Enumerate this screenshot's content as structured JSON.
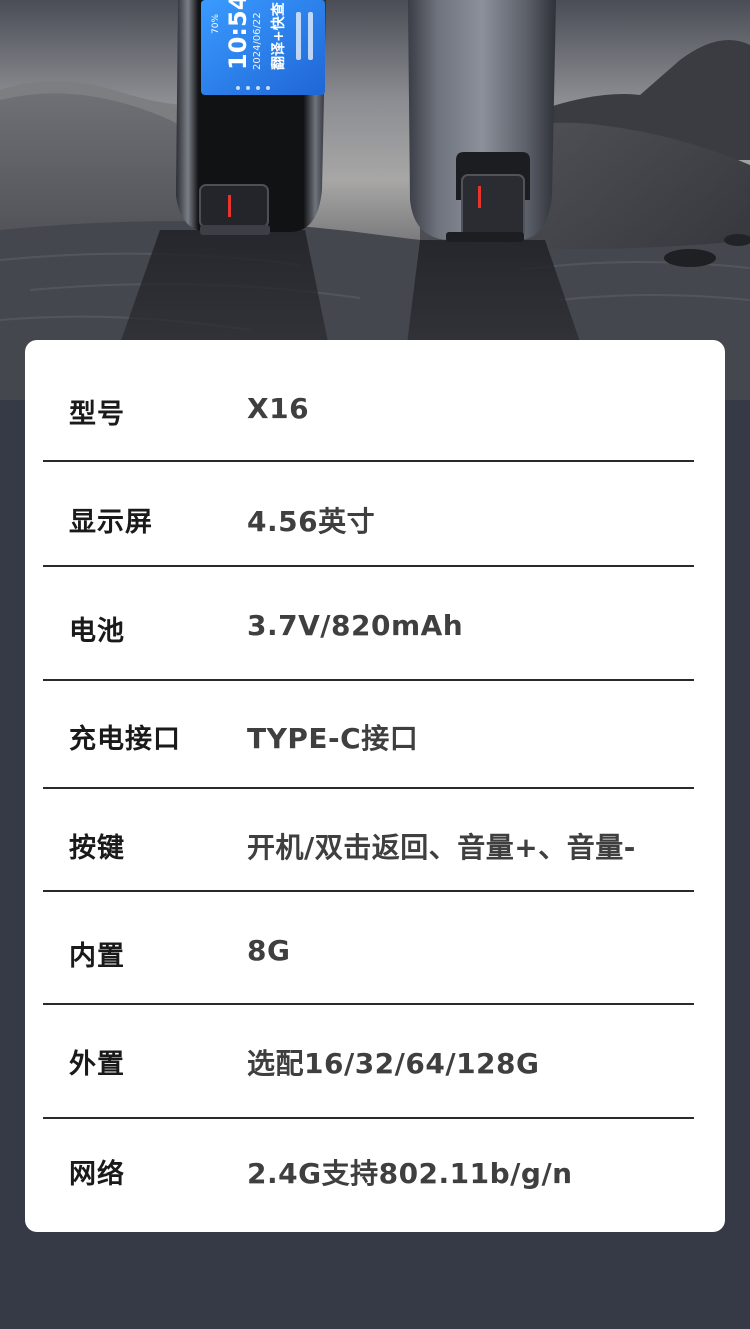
{
  "device_screen": {
    "time": "10:54",
    "date": "2024/06/22",
    "battery": "70%",
    "mode": "翻译+快查"
  },
  "specs": [
    {
      "label": "型号",
      "value": "X16"
    },
    {
      "label": "显示屏",
      "value": "4.56英寸"
    },
    {
      "label": "电池",
      "value": "3.7V/820mAh"
    },
    {
      "label": "充电接口",
      "value": "TYPE-C接口"
    },
    {
      "label": "按键",
      "value": "开机/双击返回、音量+、音量-"
    },
    {
      "label": "内置",
      "value": "8G"
    },
    {
      "label": "外置",
      "value": "选配16/32/64/128G"
    },
    {
      "label": "网络",
      "value": "2.4G支持802.11b/g/n"
    }
  ],
  "colors": {
    "page_background": "#363a46",
    "card_background": "#ffffff",
    "screen_blue": "#2f86f0",
    "button_red": "#e8342c"
  }
}
